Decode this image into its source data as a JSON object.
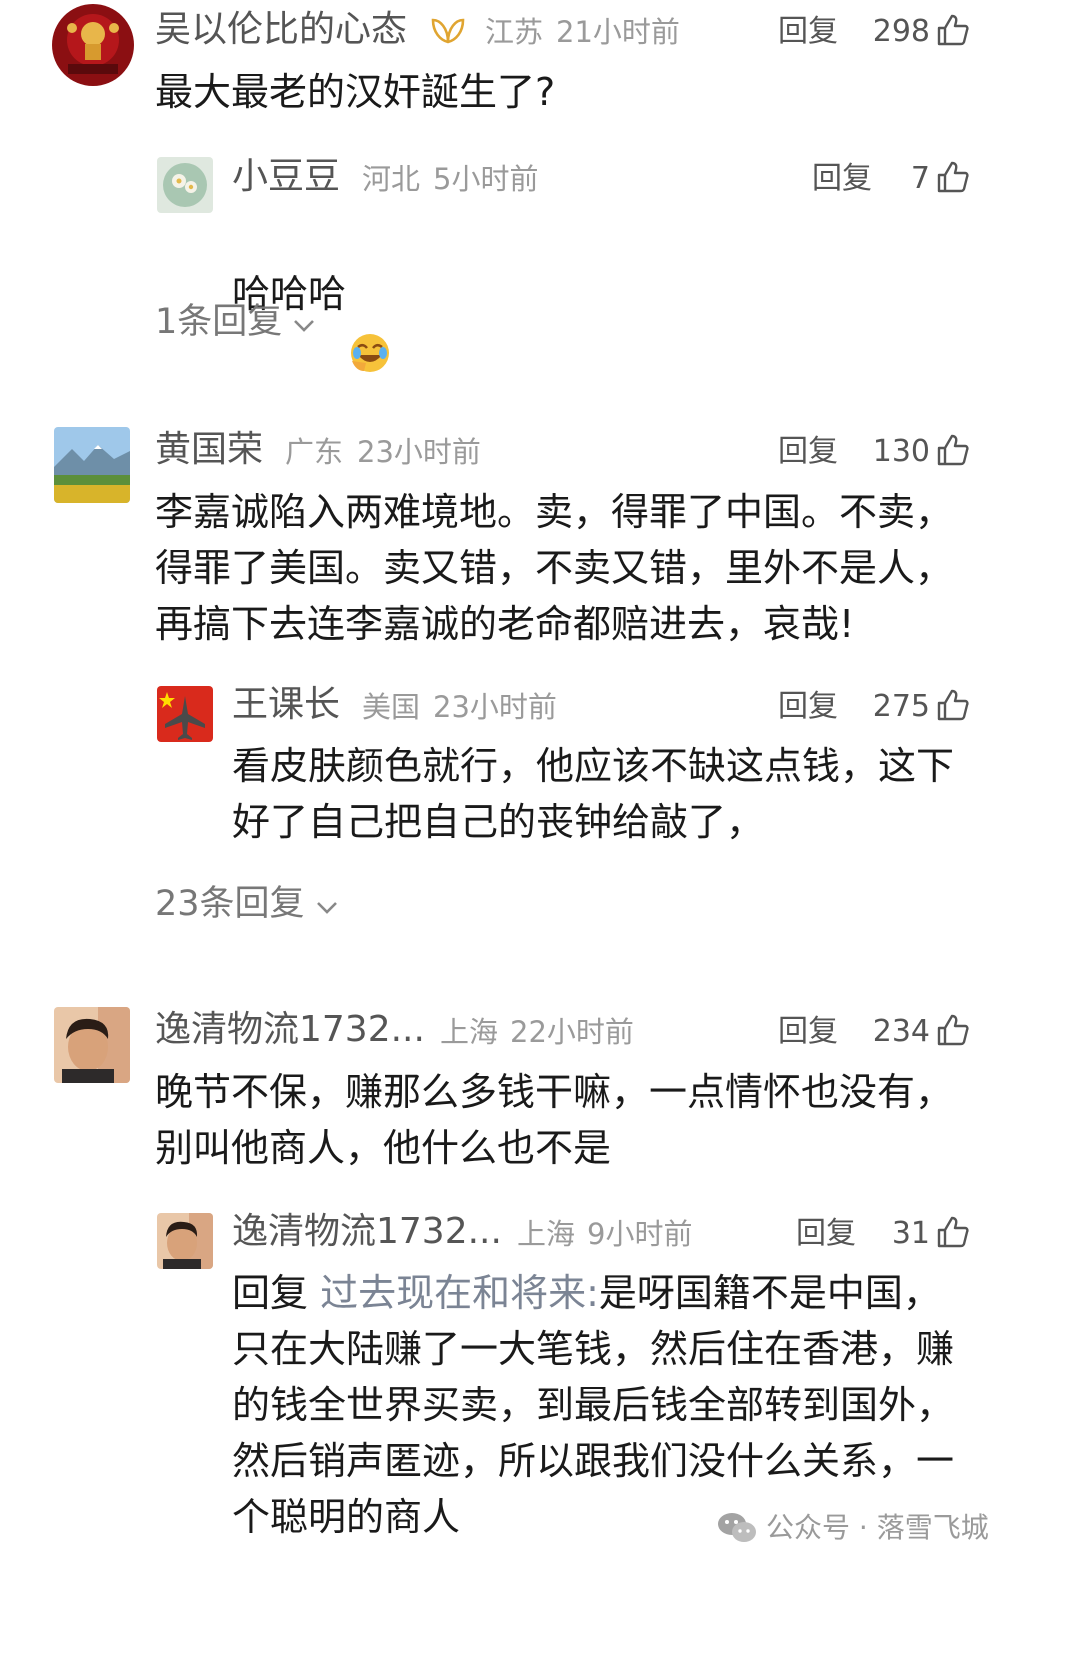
{
  "comments": [
    {
      "user": "吴以伦比的心态",
      "location": "江苏",
      "time": "21小时前",
      "reply_label": "回复",
      "likes": "298",
      "text": "最大最老的汉奸誕生了?",
      "replies": [
        {
          "user": "小豆豆",
          "location": "河北",
          "time": "5小时前",
          "reply_label": "回复",
          "likes": "7",
          "text": "哈哈哈"
        }
      ],
      "more_replies": "1条回复"
    },
    {
      "user": "黄国荣",
      "location": "广东",
      "time": "23小时前",
      "reply_label": "回复",
      "likes": "130",
      "text": "李嘉诚陷入两难境地。卖，得罪了中国。不卖，\n得罪了美国。卖又错，不卖又错，里外不是人，\n再搞下去连李嘉诚的老命都赔进去，哀哉!",
      "replies": [
        {
          "user": "王课长",
          "location": "美国",
          "time": "23小时前",
          "reply_label": "回复",
          "likes": "275",
          "text": "看皮肤颜色就行，他应该不缺这点钱，这下\n好了自己把自己的丧钟给敲了，"
        }
      ],
      "more_replies": "23条回复"
    },
    {
      "user": "逸清物流1732...",
      "location": "上海",
      "time": "22小时前",
      "reply_label": "回复",
      "likes": "234",
      "text": "晚节不保，赚那么多钱干嘛，一点情怀也没有，\n别叫他商人，他什么也不是",
      "replies": [
        {
          "user": "逸清物流1732...",
          "location": "上海",
          "time": "9小时前",
          "reply_label": "回复",
          "likes": "31",
          "reply_prefix": "回复 ",
          "reply_to": "过去现在和将来:",
          "text": "是呀国籍不是中国，\n只在大陆赚了一大笔钱，然后住在香港，赚\n的钱全世界买卖，到最后钱全部转到国外，\n然后销声匿迹，所以跟我们没什么关系，一\n个聪明的商人"
        }
      ]
    }
  ],
  "watermark": "公众号 · 落雪飞城",
  "colors": {
    "name": "#555555",
    "meta": "#9a9a9a",
    "quote": "#7b8494",
    "text": "#1a1a1a"
  }
}
